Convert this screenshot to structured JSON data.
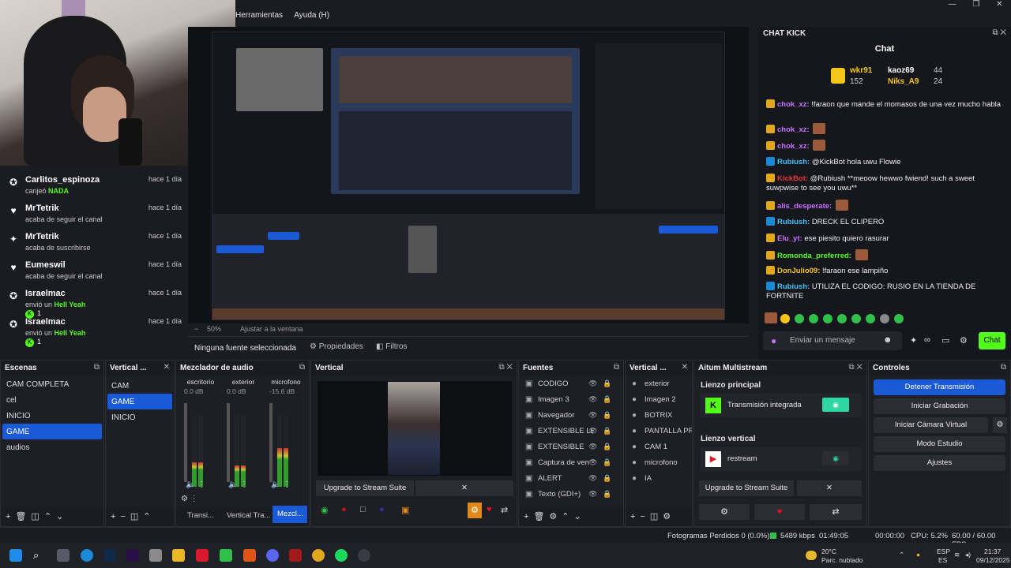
{
  "menubar": {
    "items": [
      "Herramientas",
      "Ayuda (H)"
    ]
  },
  "window": {
    "minimize": "—",
    "maximize": "❐",
    "close": "✕"
  },
  "activity": [
    {
      "icon": "kick-icon",
      "name": "Carlitos_espinoza",
      "time": "hace 1 día",
      "action": "canjeó ",
      "highlight": "NADA",
      "count": ""
    },
    {
      "icon": "heart-icon",
      "name": "MrTetrik",
      "time": "hace 1 día",
      "action": "acaba de seguir el canal",
      "highlight": "",
      "count": ""
    },
    {
      "icon": "star-icon",
      "name": "MrTetrik",
      "time": "hace 1 día",
      "action": "acaba de suscribirse",
      "highlight": "",
      "count": ""
    },
    {
      "icon": "heart-icon",
      "name": "Eumeswil",
      "time": "hace 1 día",
      "action": "acaba de seguir el canal",
      "highlight": "",
      "count": ""
    },
    {
      "icon": "kick-icon",
      "name": "Israelmac",
      "time": "hace 1 día",
      "action": "envió un ",
      "highlight": "Hell Yeah",
      "count": "1"
    },
    {
      "icon": "kick-icon",
      "name": "Israelmac",
      "time": "hace 1 día",
      "action": "envió un ",
      "highlight": "Hell Yeah",
      "count": "1"
    }
  ],
  "preview": {
    "zoom": "50%",
    "fit": "Ajustar a la ventana"
  },
  "source_bar": {
    "label": "Ninguna fuente seleccionada",
    "properties": "Propiedades",
    "filters": "Filtros"
  },
  "chat": {
    "dock_title": "CHAT KICK",
    "title": "Chat",
    "leaderboard": [
      {
        "name": "wkr91",
        "points": "152",
        "color": "#f5c518"
      },
      {
        "name": "kaoz69",
        "points": "44",
        "color": "#ffffff"
      },
      {
        "name": "Niks_A9",
        "points": "24",
        "color": "#f5c518"
      }
    ],
    "messages": [
      {
        "user": "chok_xz:",
        "color": "#c86fff",
        "text": "!faraon que mande el momasos de una vez mucho habla"
      },
      {
        "user": "chok_xz:",
        "color": "#c86fff",
        "text": ""
      },
      {
        "user": "chok_xz:",
        "color": "#c86fff",
        "text": ""
      },
      {
        "user": "Rubiush:",
        "color": "#3ec3ff",
        "text": "@KickBot hola uwu Flowie"
      },
      {
        "user": "KickBot:",
        "color": "#e8333a",
        "text": "@Rubiush **meoow hewwo fwiend! such a sweet suwpwise to see you uwu**"
      },
      {
        "user": "alis_desperate:",
        "color": "#c86fff",
        "text": ""
      },
      {
        "user": "Rubiush:",
        "color": "#3ec3ff",
        "text": "DRECK EL CLIPERO"
      },
      {
        "user": "Elu_yt:",
        "color": "#c86fff",
        "text": "ese piesito quiero rasurar"
      },
      {
        "user": "Romonda_preferred:",
        "color": "#53fc18",
        "text": ""
      },
      {
        "user": "DonJulio09:",
        "color": "#f5c518",
        "text": "!faraon ese lampiño"
      },
      {
        "user": "Rubiush:",
        "color": "#3ec3ff",
        "text": "UTILIZA EL CODIGO: RUSIO EN LA TIENDA DE FORTNITE"
      }
    ],
    "input_placeholder": "Enviar un mensaje",
    "send": "Chat"
  },
  "docks": {
    "scenes": {
      "title": "Escenas",
      "items": [
        "CAM COMPLETA",
        "cel",
        "INICIO",
        "GAME",
        "audios"
      ],
      "selected": 3
    },
    "vertical_scenes": {
      "title": "Vertical ...",
      "items": [
        "CAM",
        "GAME",
        "INICIO"
      ],
      "selected": 1
    },
    "mixer": {
      "title": "Mezclador de audio",
      "channels": [
        {
          "name": "escritorio",
          "db": "0.0 dB",
          "level": 0.35
        },
        {
          "name": "exterior",
          "db": "0.0 dB",
          "level": 0.3
        },
        {
          "name": "microfono",
          "db": "-15.6 dB",
          "level": 0.55
        }
      ],
      "tabs": [
        "Transi...",
        "Vertical Tra...",
        "Mezcl..."
      ]
    },
    "vertical_preview": {
      "title": "Vertical",
      "upgrade": "Upgrade to Stream Suite"
    },
    "sources": {
      "title": "Fuentes",
      "items": [
        "CODIGO",
        "Imagen 3",
        "Navegador",
        "EXTENSIBLE LE",
        "EXTENSIBLE",
        "Captura de ven",
        "ALERT",
        "Texto (GDI+)"
      ]
    },
    "vertical_sources": {
      "title": "Vertical ...",
      "items": [
        "exterior",
        "Imagen 2",
        "BOTRIX",
        "PANTALLA PRIN",
        "CAM 1",
        "microfono",
        "IA"
      ]
    },
    "multistream": {
      "title": "Aitum Multistream",
      "main_canvas": "Lienzo principal",
      "main_target": "Transmisión integrada",
      "vertical_canvas": "Lienzo vertical",
      "vertical_target": "restream",
      "upgrade": "Upgrade to Stream Suite"
    },
    "controls": {
      "title": "Controles",
      "buttons": [
        "Detener Transmisión",
        "Iniciar Grabación",
        "Iniciar Cámara Virtual",
        "Modo Estudio",
        "Ajustes"
      ]
    }
  },
  "status": {
    "frames": "Fotogramas Perdidos 0 (0.0%)",
    "kbps": "5489 kbps",
    "live": "01:49:05",
    "rec": "00:00:00",
    "cpu": "CPU: 5.2%",
    "fps": "60.00 / 60.00 FPS"
  },
  "taskbar": {
    "weather_temp": "20°C",
    "weather_desc": "Parc. nublado",
    "lang1": "ESP",
    "lang2": "ES",
    "time": "21:37",
    "date": "09/12/2025"
  }
}
